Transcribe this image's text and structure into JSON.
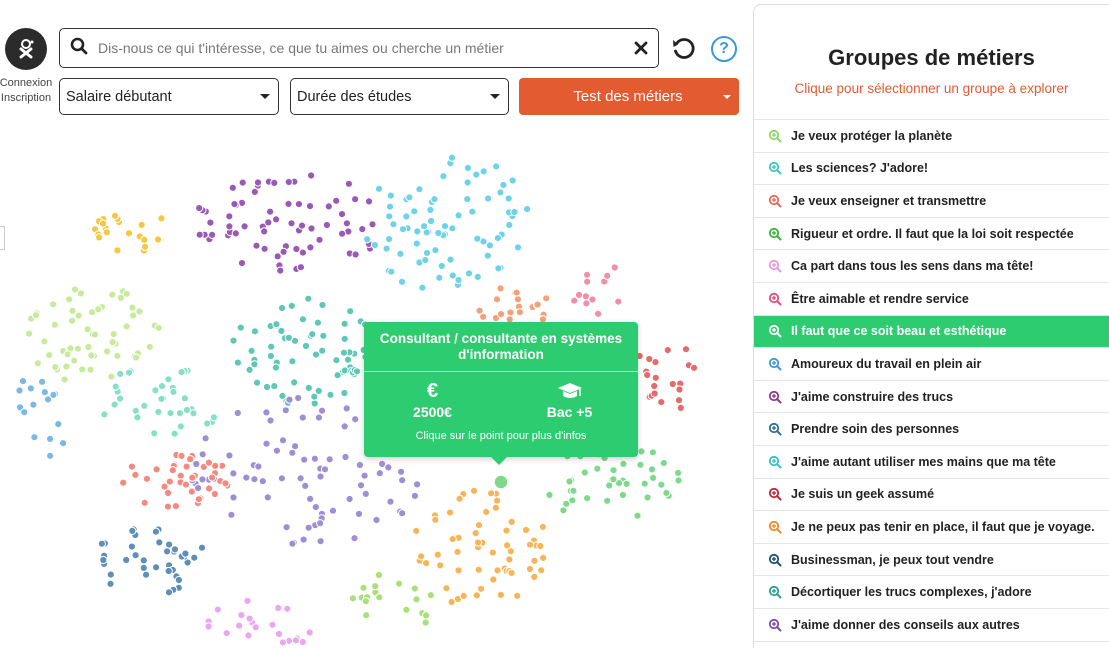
{
  "user": {
    "login": "Connexion",
    "register": "Inscription"
  },
  "search": {
    "placeholder": "Dis-nous ce qui t'intéresse, ce que tu aimes ou cherche un métier"
  },
  "filters": {
    "salary": "Salaire débutant",
    "duration": "Durée des études",
    "test": "Test des métiers"
  },
  "tooltip": {
    "title": "Consultant / consultante en systèmes d'information",
    "salary_icon": "€",
    "salary": "2500€",
    "study": "Bac +5",
    "hint": "Clique sur le point pour plus d'infos"
  },
  "panel": {
    "title": "Groupes de métiers",
    "subtitle": "Clique pour sélectionner un groupe à explorer",
    "groups": [
      {
        "label": "Je veux protéger la planète",
        "color": "#8fd66a"
      },
      {
        "label": "Les sciences? J'adore!",
        "color": "#3cc7c4"
      },
      {
        "label": "Je veux enseigner et transmettre",
        "color": "#e9685a"
      },
      {
        "label": "Rigueur et ordre. Il faut que la loi soit respectée",
        "color": "#3bb33f"
      },
      {
        "label": "Ca part dans tous les sens dans ma tête!",
        "color": "#e39ae0"
      },
      {
        "label": "Être aimable et rendre service",
        "color": "#df4f7b"
      },
      {
        "label": "Il faut que ce soit beau et esthétique",
        "color": "#ffffff",
        "active": true
      },
      {
        "label": "Amoureux du travail en plein air",
        "color": "#3a9ad9"
      },
      {
        "label": "J'aime construire des trucs",
        "color": "#8e3b8e"
      },
      {
        "label": "Prendre soin des personnes",
        "color": "#2f6f9a"
      },
      {
        "label": "J'aime autant utiliser mes mains que ma tête",
        "color": "#38c1c9"
      },
      {
        "label": "Je suis un geek assumé",
        "color": "#c0263a"
      },
      {
        "label": "Je ne peux pas tenir en place, il faut que je voyage.",
        "color": "#ef8a2c"
      },
      {
        "label": "Businessman, je peux tout vendre",
        "color": "#1d4f7a"
      },
      {
        "label": "Décortiquer les trucs complexes, j'adore",
        "color": "#2aa08e"
      },
      {
        "label": "J'aime donner des conseils aux autres",
        "color": "#7a4fa6"
      }
    ]
  },
  "scatter": {
    "clusters": [
      {
        "name": "yellow",
        "color": "#f5c842",
        "n": 20
      },
      {
        "name": "purple",
        "color": "#9b59b6",
        "n": 70
      },
      {
        "name": "cyan",
        "color": "#6ed3e8",
        "n": 80
      },
      {
        "name": "teal",
        "color": "#5ec8b5",
        "n": 70
      },
      {
        "name": "lightgreen",
        "color": "#c7ea9c",
        "n": 55
      },
      {
        "name": "mint",
        "color": "#86e0c6",
        "n": 35
      },
      {
        "name": "lightblue",
        "color": "#7ab8e8",
        "n": 16
      },
      {
        "name": "lavender",
        "color": "#9e8fd4",
        "n": 85
      },
      {
        "name": "salmon",
        "color": "#f48a7f",
        "n": 40
      },
      {
        "name": "steelblue",
        "color": "#5e8fb8",
        "n": 40
      },
      {
        "name": "orange",
        "color": "#f7b558",
        "n": 60
      },
      {
        "name": "green",
        "color": "#7ed98a",
        "n": 40
      },
      {
        "name": "pink",
        "color": "#ef8fa8",
        "n": 12
      },
      {
        "name": "red",
        "color": "#e36b6b",
        "n": 20
      },
      {
        "name": "lime",
        "color": "#a8e07a",
        "n": 18
      },
      {
        "name": "violet",
        "color": "#eaa6ef",
        "n": 22
      },
      {
        "name": "coral",
        "color": "#f4a07a",
        "n": 20
      }
    ]
  }
}
